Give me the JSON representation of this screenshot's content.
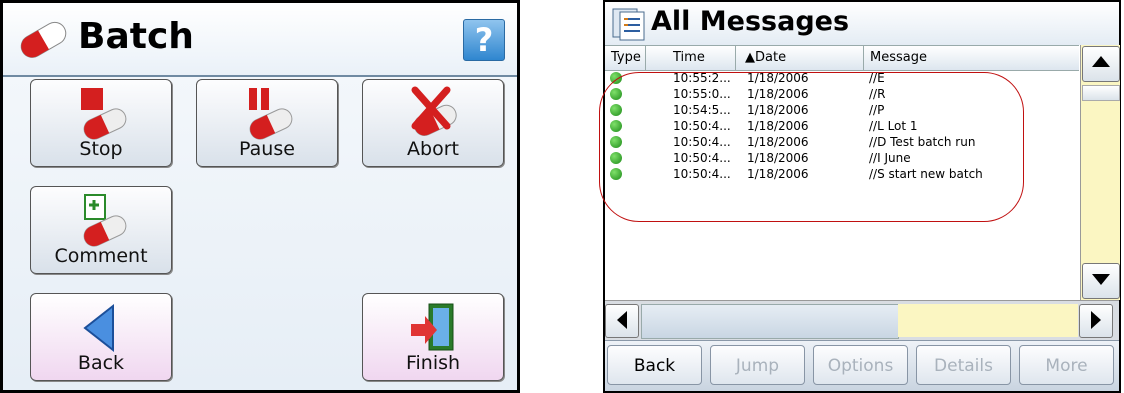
{
  "batch_screen": {
    "title": "Batch",
    "help": "?",
    "buttons": {
      "stop": "Stop",
      "pause": "Pause",
      "abort": "Abort",
      "comment": "Comment",
      "back": "Back",
      "finish": "Finish"
    }
  },
  "messages_screen": {
    "title": "All Messages",
    "columns": {
      "type": "Type",
      "time": "Time",
      "date": "▲Date",
      "message": "Message"
    },
    "rows": [
      {
        "time": "10:55:2...",
        "date": "1/18/2006",
        "message": "//E"
      },
      {
        "time": "10:55:0...",
        "date": "1/18/2006",
        "message": "//R"
      },
      {
        "time": "10:54:5...",
        "date": "1/18/2006",
        "message": "//P"
      },
      {
        "time": "10:50:4...",
        "date": "1/18/2006",
        "message": "//L Lot 1"
      },
      {
        "time": "10:50:4...",
        "date": "1/18/2006",
        "message": "//D Test batch run"
      },
      {
        "time": "10:50:4...",
        "date": "1/18/2006",
        "message": "//I June"
      },
      {
        "time": "10:50:4...",
        "date": "1/18/2006",
        "message": "//S start new batch"
      }
    ],
    "footer": {
      "back": "Back",
      "jump": "Jump",
      "options": "Options",
      "details": "Details",
      "more": "More"
    }
  }
}
